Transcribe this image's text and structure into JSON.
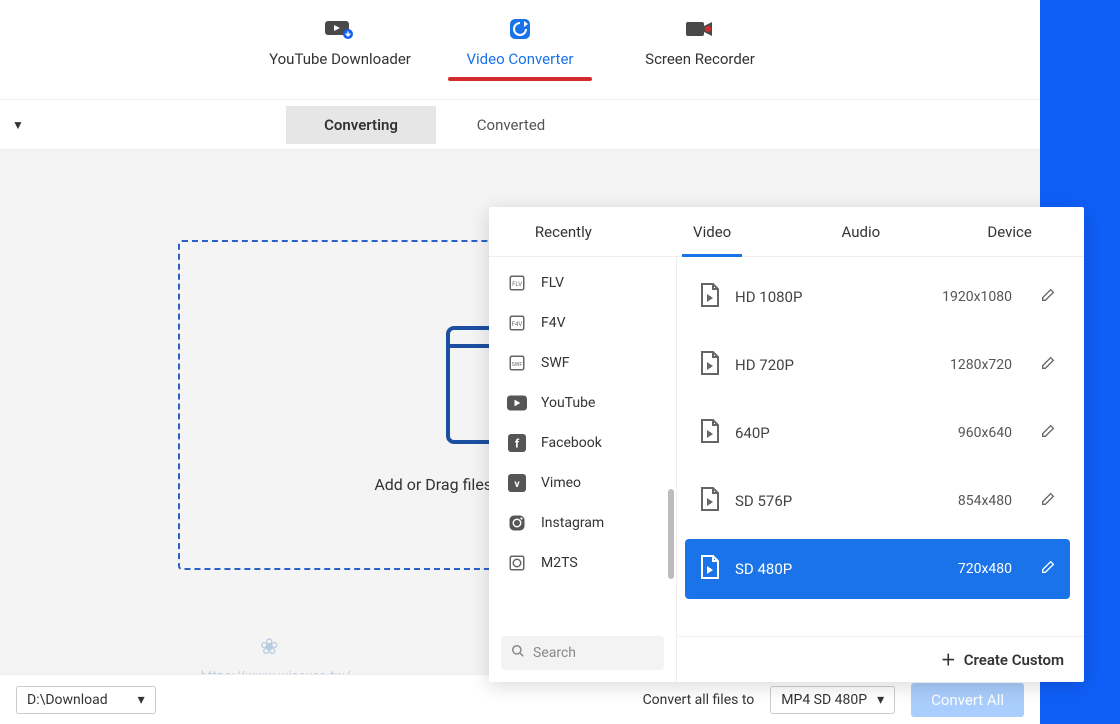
{
  "topTabs": {
    "downloader": "YouTube Downloader",
    "converter": "Video Converter",
    "recorder": "Screen Recorder"
  },
  "subTabs": {
    "converting": "Converting",
    "converted": "Converted"
  },
  "dropArea": {
    "hint": "Add or Drag files here to start converting"
  },
  "popup": {
    "tabs": {
      "recently": "Recently",
      "video": "Video",
      "audio": "Audio",
      "device": "Device"
    },
    "formats": [
      {
        "label": "FLV",
        "icon": "flv"
      },
      {
        "label": "F4V",
        "icon": "f4v"
      },
      {
        "label": "SWF",
        "icon": "swf"
      },
      {
        "label": "YouTube",
        "icon": "youtube"
      },
      {
        "label": "Facebook",
        "icon": "facebook"
      },
      {
        "label": "Vimeo",
        "icon": "vimeo"
      },
      {
        "label": "Instagram",
        "icon": "instagram"
      },
      {
        "label": "M2TS",
        "icon": "m2ts"
      }
    ],
    "searchPlaceholder": "Search",
    "resolutions": [
      {
        "name": "HD 1080P",
        "dim": "1920x1080",
        "selected": false
      },
      {
        "name": "HD 720P",
        "dim": "1280x720",
        "selected": false
      },
      {
        "name": "640P",
        "dim": "960x640",
        "selected": false
      },
      {
        "name": "SD 576P",
        "dim": "854x480",
        "selected": false
      },
      {
        "name": "SD 480P",
        "dim": "720x480",
        "selected": true
      }
    ],
    "createCustom": "Create Custom"
  },
  "bottom": {
    "outputPath": "D:\\Download",
    "convertLabel": "Convert all files to",
    "selectedFormat": "MP4 SD 480P",
    "convertAll": "Convert All"
  },
  "watermark": "https://www.wiseyes.tw/"
}
